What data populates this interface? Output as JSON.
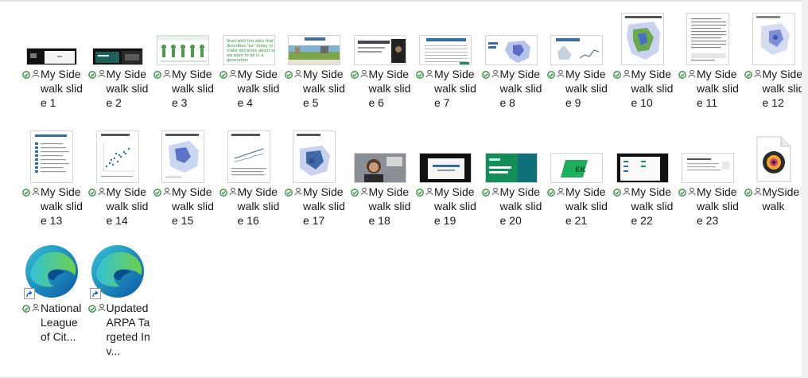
{
  "files": [
    {
      "id": "s1",
      "name": "My Sidewalk slide 1",
      "label": "My Sidewalk slide 1",
      "thumb": "small",
      "style": "dark-small"
    },
    {
      "id": "s2",
      "name": "My Sidewalk slide 2",
      "label": "My Sidewalk slide 2",
      "thumb": "small",
      "style": "dark-teal"
    },
    {
      "id": "s3",
      "name": "My Sidewalk slide 3",
      "label": "My Sidewalk slide 3",
      "thumb": "landscape",
      "style": "figures"
    },
    {
      "id": "s4",
      "name": "My Sidewalk slide 4",
      "label": "My Sidewalk slide 4",
      "thumb": "landscape",
      "style": "quote",
      "quote": "Start with the data that describes \"us\" today to make decisions about who we want to be in a generation"
    },
    {
      "id": "s5",
      "name": "My Sidewalk slide 5",
      "label": "My Sidewalk slide 5",
      "thumb": "landscape",
      "style": "landscape-photo"
    },
    {
      "id": "s6",
      "name": "My Sidewalk slide 6",
      "label": "My Sidewalk slide 6",
      "thumb": "landscape",
      "style": "webcam-side"
    },
    {
      "id": "s7",
      "name": "My Sidewalk slide 7",
      "label": "My Sidewalk slide 7",
      "thumb": "landscape",
      "style": "table"
    },
    {
      "id": "s8",
      "name": "My Sidewalk slide 8",
      "label": "My Sidewalk slide 8",
      "thumb": "landscape",
      "style": "map"
    },
    {
      "id": "s9",
      "name": "My Sidewalk slide 9",
      "label": "My Sidewalk slide 9",
      "thumb": "landscape",
      "style": "chart"
    },
    {
      "id": "s10",
      "name": "My Sidewalk slide 10",
      "label": "My Sidewalk slide 10",
      "thumb": "portrait",
      "style": "portrait-map"
    },
    {
      "id": "s11",
      "name": "My Sidewalk slide 11",
      "label": "My Sidewalk slide 11",
      "thumb": "portrait",
      "style": "portrait-text"
    },
    {
      "id": "s12",
      "name": "My Sidewalk slide 12",
      "label": "My Sidewalk slide 12",
      "thumb": "portrait",
      "style": "portrait-map-light"
    },
    {
      "id": "s13",
      "name": "My Sidewalk slide 13",
      "label": "My Sidewalk slide 13",
      "thumb": "portrait",
      "style": "portrait-list"
    },
    {
      "id": "s14",
      "name": "My Sidewalk slide 14",
      "label": "My Sidewalk slide 14",
      "thumb": "portrait",
      "style": "portrait-scatter"
    },
    {
      "id": "s15",
      "name": "My Sidewalk slide 15",
      "label": "My Sidewalk slide 15",
      "thumb": "portrait",
      "style": "portrait-map2"
    },
    {
      "id": "s16",
      "name": "My Sidewalk slide 16",
      "label": "My Sidewalk slide 16",
      "thumb": "portrait",
      "style": "portrait-line"
    },
    {
      "id": "s17",
      "name": "My Sidewalk slide 17",
      "label": "My Sidewalk slide 17",
      "thumb": "portrait",
      "style": "portrait-map3"
    },
    {
      "id": "s18",
      "name": "My Sidewalk slide 18",
      "label": "My Sidewalk slide 18",
      "thumb": "landscape",
      "style": "webcam"
    },
    {
      "id": "s19",
      "name": "My Sidewalk slide 19",
      "label": "My Sidewalk slide 19",
      "thumb": "landscape",
      "style": "dark-center"
    },
    {
      "id": "s20",
      "name": "My Sidewalk slide 20",
      "label": "My Sidewalk slide 20",
      "thumb": "landscape",
      "style": "green"
    },
    {
      "id": "s21",
      "name": "My Sidewalk slide 21",
      "label": "My Sidewalk slide 21",
      "thumb": "landscape",
      "style": "logo-green",
      "logo_text": "EK"
    },
    {
      "id": "s22",
      "name": "My Sidewalk slide 22",
      "label": "My Sidewalk slide 22",
      "thumb": "landscape",
      "style": "dark-frame"
    },
    {
      "id": "s23",
      "name": "My Sidewalk slide 23",
      "label": "My Sidewalk slide 23",
      "thumb": "landscape",
      "style": "white-doc"
    },
    {
      "id": "mysidewalk",
      "name": "MySidewalk",
      "label": "MySidewalk",
      "thumb": "file",
      "style": "media"
    },
    {
      "id": "nlc",
      "name": "National League of Cities",
      "label": "National League of Cit...",
      "thumb": "edge",
      "style": "edge",
      "shortcut": true
    },
    {
      "id": "arpa",
      "name": "Updated ARPA Targeted Investments",
      "label": "Updated ARPA Targeted Inv...",
      "thumb": "edge",
      "style": "edge",
      "shortcut": true
    }
  ],
  "colors": {
    "sync_green": "#2e8b3a",
    "edge_blue": "#0c59a4",
    "edge_teal": "#34c1d6",
    "edge_green": "#6dd14b",
    "accent_green": "#1f8a5e"
  }
}
